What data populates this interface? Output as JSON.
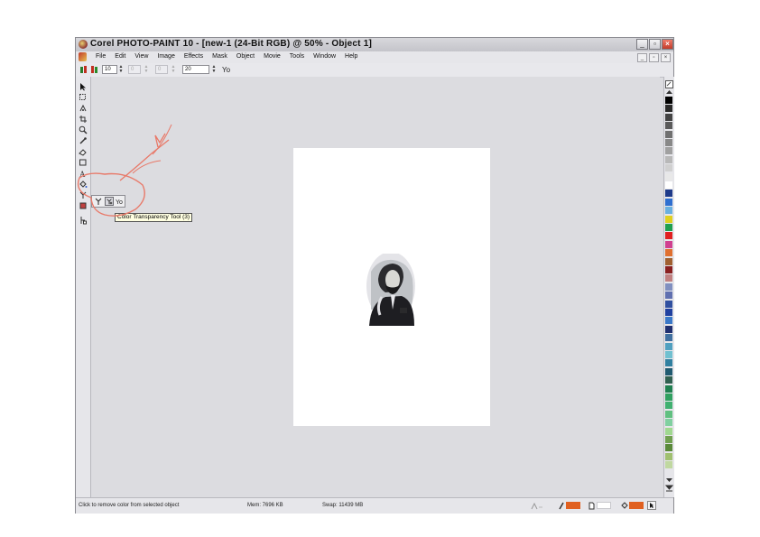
{
  "window": {
    "title": "Corel PHOTO-PAINT 10 - [new-1 (24-Bit RGB) @ 50% - Object 1]",
    "controls": {
      "minimize": "_",
      "maximize": "▫",
      "close": "×"
    }
  },
  "menu": {
    "items": [
      "File",
      "Edit",
      "View",
      "Image",
      "Effects",
      "Mask",
      "Object",
      "Movie",
      "Tools",
      "Window",
      "Help"
    ],
    "doc_controls": {
      "minimize": "_",
      "restore": "▫",
      "close": "×"
    }
  },
  "property_bar": {
    "field1": "10",
    "field2": "0",
    "field3": "0",
    "field4": "20"
  },
  "tooltip": {
    "text": "Color Transparency Tool (3)"
  },
  "status": {
    "hint": "Click to remove color from selected object",
    "mem": "Mem: 7696 KB",
    "swap": "Swap: 11439 MB"
  },
  "colors": {
    "annotation": "#e87a6a",
    "fill_swatch": "#e06020",
    "tooltip_bg": "#ffffe1"
  },
  "palette": [
    "#000000",
    "#2a2a2a",
    "#444444",
    "#5a5a5a",
    "#707070",
    "#888888",
    "#a0a0a0",
    "#b8b8b8",
    "#d0d0d0",
    "#e8e8e8",
    "#ffffff",
    "#1e3a8a",
    "#2f6fd0",
    "#6ab0e0",
    "#e0d020",
    "#20a050",
    "#e02020",
    "#d04090",
    "#e07030",
    "#a06030",
    "#8a2020",
    "#c08080",
    "#8090c0",
    "#6070b0",
    "#3050a0",
    "#2040a0",
    "#3a78c8",
    "#203070",
    "#4070a0",
    "#50a0c0",
    "#70c0d0",
    "#3080a0",
    "#205a70",
    "#306050",
    "#208050",
    "#30a060",
    "#40b070",
    "#60c080",
    "#80d0a0",
    "#a0d890",
    "#70a050",
    "#5a8a3a",
    "#a0c070",
    "#c0d8a0"
  ]
}
